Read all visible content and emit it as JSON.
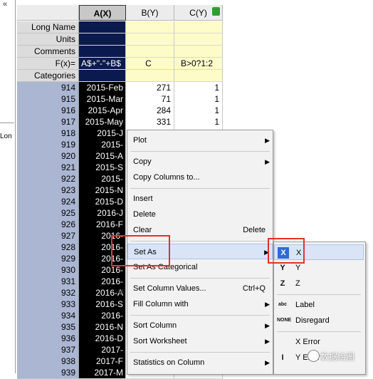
{
  "left_pane": {
    "label": "Lon",
    "chevron": "«"
  },
  "columns": [
    {
      "name": "A(X)"
    },
    {
      "name": "B(Y)"
    },
    {
      "name": "C(Y)"
    }
  ],
  "meta_rows": [
    {
      "label": "Long Name",
      "a": "",
      "b": "",
      "c": ""
    },
    {
      "label": "Units",
      "a": "",
      "b": "",
      "c": ""
    },
    {
      "label": "Comments",
      "a": "",
      "b": "",
      "c": ""
    },
    {
      "label": "F(x)=",
      "a": "A$+\"-\"+B$",
      "b": "C",
      "c": "B>0?1:2"
    },
    {
      "label": "Categories",
      "a": "",
      "b": "",
      "c": ""
    }
  ],
  "data_rows": [
    {
      "n": "914",
      "a": "2015-Feb",
      "b": "271",
      "c": "1"
    },
    {
      "n": "915",
      "a": "2015-Mar",
      "b": "71",
      "c": "1"
    },
    {
      "n": "916",
      "a": "2015-Apr",
      "b": "284",
      "c": "1"
    },
    {
      "n": "917",
      "a": "2015-May",
      "b": "331",
      "c": "1"
    },
    {
      "n": "918",
      "a": "2015-J",
      "b": "",
      "c": ""
    },
    {
      "n": "919",
      "a": "2015-",
      "b": "",
      "c": ""
    },
    {
      "n": "920",
      "a": "2015-A",
      "b": "",
      "c": ""
    },
    {
      "n": "921",
      "a": "2015-S",
      "b": "",
      "c": ""
    },
    {
      "n": "922",
      "a": "2015-",
      "b": "",
      "c": ""
    },
    {
      "n": "923",
      "a": "2015-N",
      "b": "",
      "c": ""
    },
    {
      "n": "924",
      "a": "2015-D",
      "b": "",
      "c": ""
    },
    {
      "n": "925",
      "a": "2016-J",
      "b": "",
      "c": ""
    },
    {
      "n": "926",
      "a": "2016-F",
      "b": "",
      "c": ""
    },
    {
      "n": "927",
      "a": "2016-",
      "b": "",
      "c": ""
    },
    {
      "n": "928",
      "a": "2016-",
      "b": "",
      "c": ""
    },
    {
      "n": "929",
      "a": "2016-",
      "b": "",
      "c": ""
    },
    {
      "n": "930",
      "a": "2016-",
      "b": "",
      "c": ""
    },
    {
      "n": "931",
      "a": "2016-",
      "b": "",
      "c": ""
    },
    {
      "n": "932",
      "a": "2016-A",
      "b": "",
      "c": ""
    },
    {
      "n": "933",
      "a": "2016-S",
      "b": "",
      "c": ""
    },
    {
      "n": "934",
      "a": "2016-",
      "b": "",
      "c": ""
    },
    {
      "n": "935",
      "a": "2016-N",
      "b": "",
      "c": ""
    },
    {
      "n": "936",
      "a": "2016-D",
      "b": "",
      "c": ""
    },
    {
      "n": "937",
      "a": "2017-",
      "b": "",
      "c": ""
    },
    {
      "n": "938",
      "a": "2017-F",
      "b": "",
      "c": ""
    },
    {
      "n": "939",
      "a": "2017-M",
      "b": "",
      "c": ""
    }
  ],
  "context_menu": {
    "items": [
      {
        "label": "Plot",
        "shortcut": "",
        "submenu": true
      },
      {
        "sep": true
      },
      {
        "label": "Copy",
        "shortcut": "",
        "submenu": true
      },
      {
        "label": "Copy Columns to...",
        "shortcut": "",
        "submenu": false
      },
      {
        "sep": true
      },
      {
        "label": "Insert",
        "shortcut": "",
        "submenu": false
      },
      {
        "label": "Delete",
        "shortcut": "",
        "submenu": false
      },
      {
        "label": "Clear",
        "shortcut": "Delete",
        "submenu": false
      },
      {
        "sep": true
      },
      {
        "label": "Set As",
        "shortcut": "",
        "submenu": true,
        "highlight": true
      },
      {
        "label": "Set As Categorical",
        "shortcut": "",
        "submenu": false
      },
      {
        "sep": true
      },
      {
        "label": "Set Column Values...",
        "shortcut": "Ctrl+Q",
        "submenu": false,
        "icon": "set-values-icon"
      },
      {
        "label": "Fill Column with",
        "shortcut": "",
        "submenu": true
      },
      {
        "sep": true
      },
      {
        "label": "Sort Column",
        "shortcut": "",
        "submenu": true
      },
      {
        "label": "Sort Worksheet",
        "shortcut": "",
        "submenu": true
      },
      {
        "sep": true
      },
      {
        "label": "Statistics on Column",
        "shortcut": "",
        "submenu": true
      }
    ]
  },
  "set_as_submenu": {
    "items": [
      {
        "icon": "X",
        "label": "X",
        "highlight": true
      },
      {
        "icon": "Y",
        "label": "Y"
      },
      {
        "icon": "Z",
        "label": "Z"
      },
      {
        "sep": true
      },
      {
        "icon": "abc",
        "label": "Label"
      },
      {
        "icon": "NONE",
        "label": "Disregard"
      },
      {
        "sep": true
      },
      {
        "icon": "",
        "label": "X Error"
      },
      {
        "icon": "I",
        "label": "Y Error"
      }
    ]
  },
  "watermark": "数据绘图",
  "colors": {
    "selection_fill": "#000000",
    "header_fill": "#0b1a4e",
    "meta_fill": "#fdfcc8",
    "highlight": "#e0322f",
    "row_number_fill": "#aab6d2"
  }
}
